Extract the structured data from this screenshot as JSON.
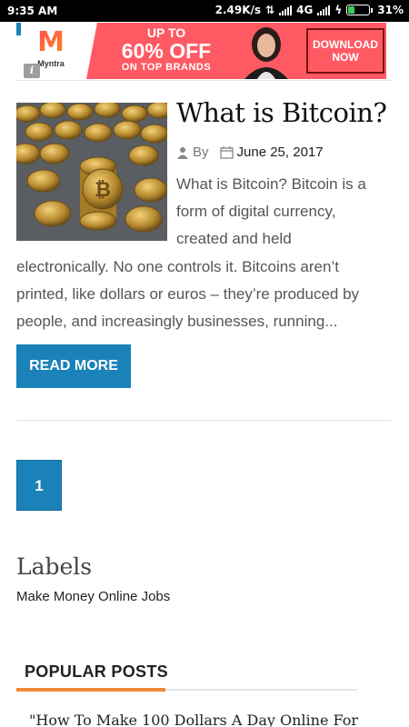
{
  "status_bar": {
    "time": "9:35 AM",
    "network_speed": "2.49K/s",
    "network_type": "4G",
    "battery": "31%",
    "battery_level": 0.31,
    "icons": [
      "data-transfer-icon",
      "signal-icon",
      "signal-icon",
      "charging-icon",
      "battery-icon"
    ]
  },
  "ad": {
    "brand": "Myntra",
    "brand_logo": "M",
    "offer_line1": "UP TO",
    "offer_line2": "60% OFF",
    "offer_line3": "ON TOP BRANDS",
    "cta": "DOWNLOAD NOW",
    "info_icon": "i",
    "colors": {
      "background": "#ff5a63",
      "accent": "#1a82b8"
    }
  },
  "post": {
    "title": "What is Bitcoin?",
    "by_label": "By",
    "date": "June 25, 2017",
    "excerpt_lines": [
      "What is Bitcoin? Bitcoin is a",
      "form of digital currency,",
      "created and held",
      "electronically. No one controls it. Bitcoins aren’t",
      "printed, like dollars or euros – they’re produced by",
      "people, and increasingly businesses, running..."
    ],
    "read_more": "READ MORE",
    "thumbnail_icon": "bitcoin-coins-image"
  },
  "pagination": {
    "current": "1"
  },
  "labels": {
    "title": "Labels",
    "items": [
      "Make Money Online Jobs"
    ]
  },
  "popular_posts": {
    "title": "POPULAR POSTS",
    "items": [
      "\"How To Make 100 Dollars A Day Online For"
    ]
  },
  "colors": {
    "primary": "#1a82b8",
    "accent_orange": "#f0883a"
  }
}
